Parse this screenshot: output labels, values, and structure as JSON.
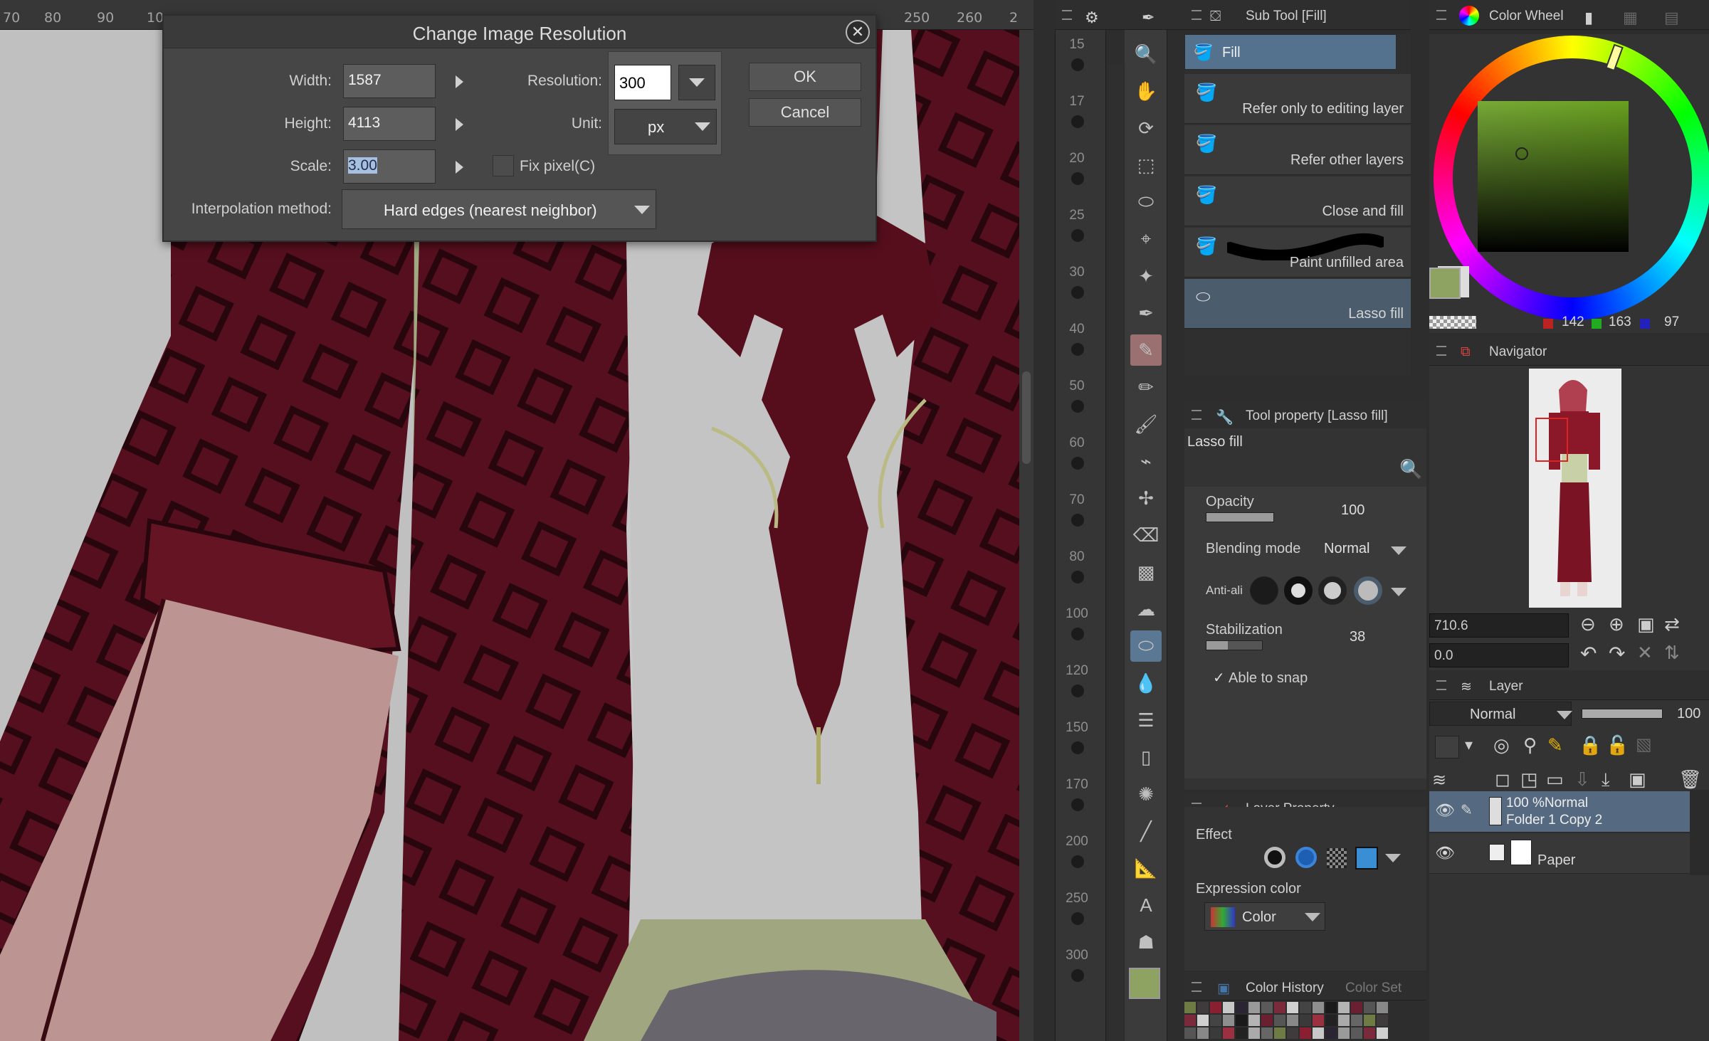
{
  "dialog": {
    "title": "Change Image Resolution",
    "width_label": "Width:",
    "width_value": "1587",
    "height_label": "Height:",
    "height_value": "4113",
    "scale_label": "Scale:",
    "scale_value": "3.00",
    "resolution_label": "Resolution:",
    "resolution_value": "300",
    "unit_label": "Unit:",
    "unit_value": "px",
    "fix_pixel_label": "Fix pixel(C)",
    "interp_label": "Interpolation method:",
    "interp_value": "Hard edges (nearest neighbor)",
    "ok_label": "OK",
    "cancel_label": "Cancel"
  },
  "top_ruler": {
    "labels": [
      "70",
      "80",
      "90",
      "10",
      "250",
      "260",
      "2"
    ]
  },
  "side_ruler": {
    "labels": [
      "15",
      "17",
      "20",
      "25",
      "30",
      "40",
      "50",
      "60",
      "70",
      "80",
      "100",
      "120",
      "150",
      "170",
      "200",
      "250",
      "300"
    ]
  },
  "subtool": {
    "header": "Sub Tool [Fill]",
    "tab": "Fill",
    "items": [
      "Refer only to editing layer",
      "Refer other layers",
      "Close and fill",
      "Paint unfilled area",
      "Lasso fill"
    ]
  },
  "tool_property": {
    "header": "Tool property [Lasso fill]",
    "name": "Lasso fill",
    "opacity_label": "Opacity",
    "opacity_value": "100",
    "blend_label": "Blending mode",
    "blend_value": "Normal",
    "aa_label": "Anti-ali",
    "stabilization_label": "Stabilization",
    "stabilization_value": "38",
    "snap_label": "Able to snap"
  },
  "layer_property": {
    "header": "Layer Property",
    "effect_label": "Effect",
    "expr_label": "Expression color",
    "expr_value": "Color"
  },
  "color_wheel": {
    "header": "Color Wheel",
    "r": "142",
    "g": "163",
    "b": "97",
    "main_color": "#8ea361"
  },
  "navigator": {
    "header": "Navigator",
    "zoom_value": "710.6",
    "angle_value": "0.0"
  },
  "layer_panel": {
    "header": "Layer",
    "blend_value": "Normal",
    "opacity_value": "100",
    "layers": [
      {
        "line1": "100 %Normal",
        "line2": "Folder 1 Copy 2"
      },
      {
        "line1": "",
        "line2": "Paper"
      }
    ]
  },
  "color_history": {
    "header": "Color History",
    "tab2": "Color Set"
  }
}
